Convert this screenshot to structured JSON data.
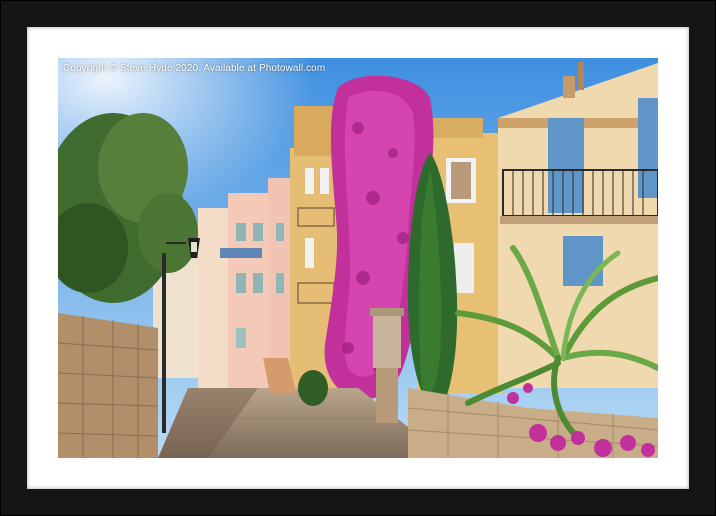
{
  "photo": {
    "caption": "Copyright  © Steve Hyde  2020. Available at Photowall.com"
  },
  "frame": {
    "frame_color": "#151515",
    "mount_color": "#ffffff"
  },
  "palette": {
    "sky_top": "#3e8fe0",
    "sky_bottom": "#b9dbf5",
    "bougainvillea": "#c2309c",
    "cypress": "#2e6a2b",
    "building_pink": "#f0c3b3",
    "building_ochre": "#e8b868",
    "stone": "#b79a78"
  }
}
